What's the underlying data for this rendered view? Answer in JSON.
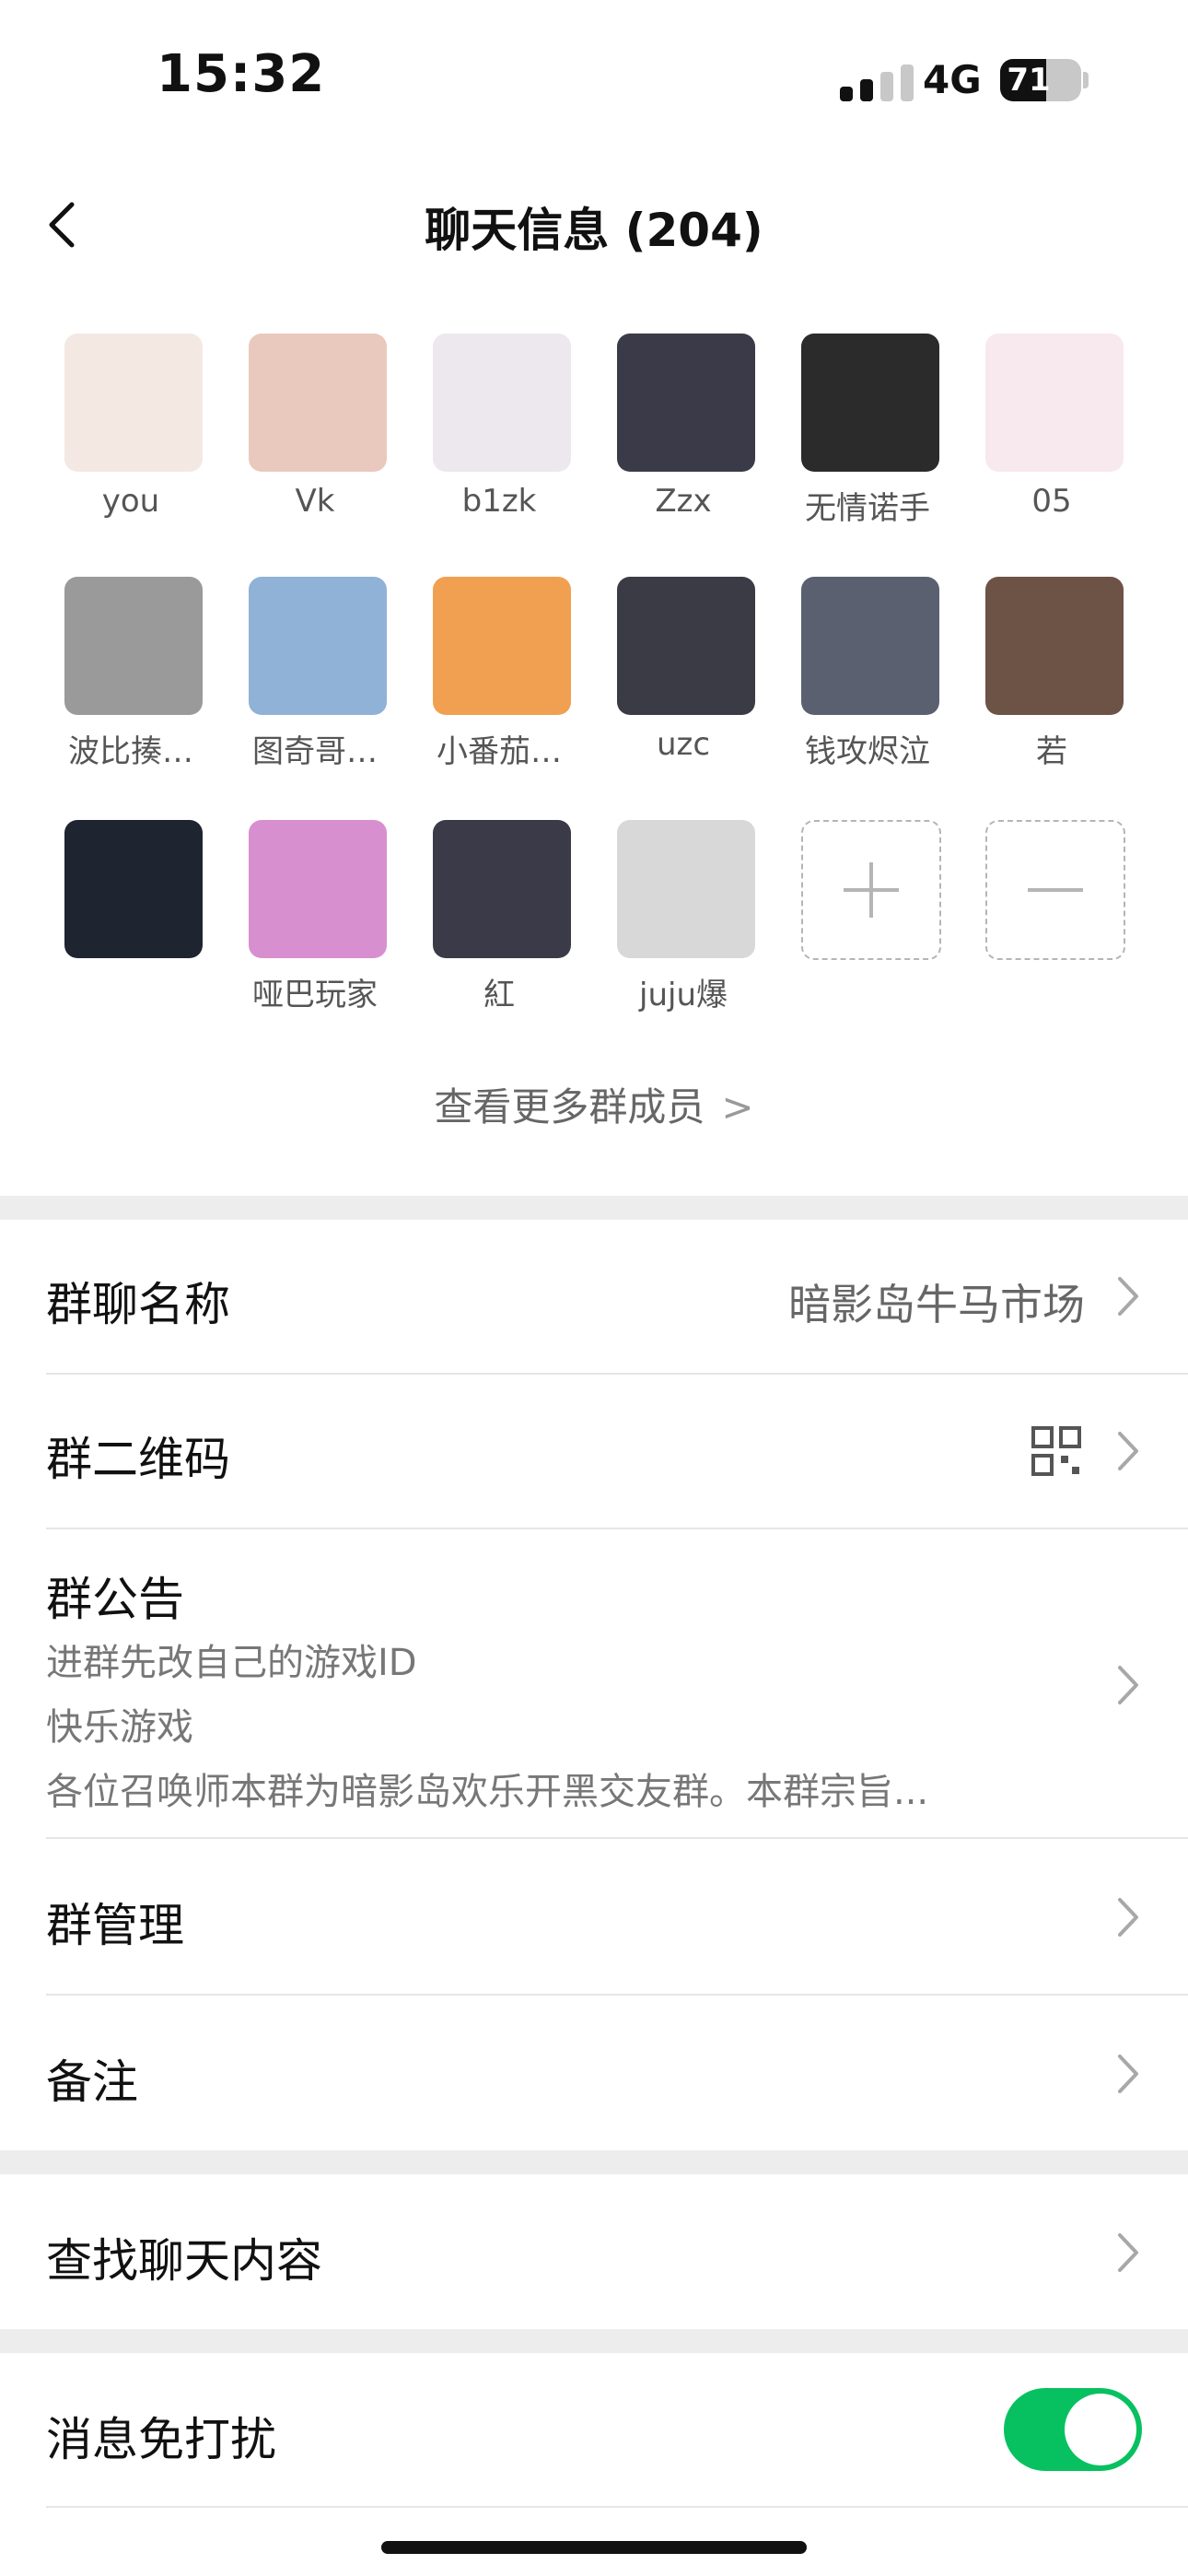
{
  "status": {
    "time": "15:32",
    "network": "4G",
    "battery": "71",
    "battery_level": 0.71
  },
  "nav": {
    "title": "聊天信息 (204)",
    "back_icon": "chevron-left-icon"
  },
  "members": [
    {
      "name": "you",
      "color": "#f3e8e2"
    },
    {
      "name": "Vk",
      "color": "#e9c9bd"
    },
    {
      "name": "b1zk",
      "color": "#ece8ee"
    },
    {
      "name": "Zzx",
      "color": "#3a3a48"
    },
    {
      "name": "无情诺手",
      "color": "#2b2b2b"
    },
    {
      "name": "05",
      "color": "#f8e9ef"
    },
    {
      "name": "波比揍…",
      "color": "#9a9a9a"
    },
    {
      "name": "图奇哥…",
      "color": "#8fb2d6"
    },
    {
      "name": "小番茄…",
      "color": "#f0a050"
    },
    {
      "name": "uzc",
      "color": "#3b3b45"
    },
    {
      "name": "钱攻烬泣",
      "color": "#5b6070"
    },
    {
      "name": "若",
      "color": "#6d5246"
    },
    {
      "name": "",
      "color": "#1e2430"
    },
    {
      "name": "哑巴玩家",
      "color": "#d88fd0"
    },
    {
      "name": "紅",
      "color": "#3a3a48"
    },
    {
      "name": "juju爆",
      "color": "#d8d8d8"
    }
  ],
  "member_actions": {
    "add_icon": "plus-icon",
    "remove_icon": "minus-icon"
  },
  "more_members": "查看更多群成员",
  "settings": {
    "group_name": {
      "label": "群聊名称",
      "value": "暗影岛牛马市场"
    },
    "qr_code": {
      "label": "群二维码",
      "icon": "qr-code-icon"
    },
    "notice": {
      "label": "群公告",
      "lines": [
        "进群先改自己的游戏ID",
        "快乐游戏",
        "各位召唤师本群为暗影岛欢乐开黑交友群。本群宗旨..."
      ]
    },
    "manage": {
      "label": "群管理"
    },
    "remark": {
      "label": "备注"
    },
    "search_history": {
      "label": "查找聊天内容"
    },
    "mute": {
      "label": "消息免打扰",
      "enabled": true
    }
  },
  "colors": {
    "accent": "#07c160",
    "divider_bg": "#ededed"
  }
}
